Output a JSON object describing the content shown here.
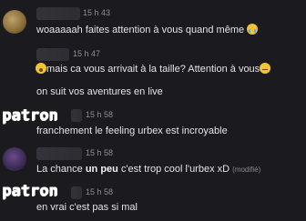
{
  "messages": [
    {
      "time": "15 h 43",
      "text": "woaaaaah faites attention à vous quand même",
      "emoji": "crying-face-icon"
    },
    {
      "time": "15 h 47",
      "text": "mais ca vous arrivait à la taille? Attention à vous",
      "emoji_start": "astonished-face-icon",
      "emoji_end": "neutral-face-icon"
    },
    {
      "text": "on suit vos aventures en live"
    },
    {
      "time": "15 h 58",
      "text": "franchement le feeling urbex est incroyable"
    },
    {
      "time": "15 h 58",
      "text_before": "La chance ",
      "text_bold": "un peu",
      "text_after": " c'est trop cool l'urbex xD",
      "edited": "(modifié)"
    },
    {
      "time": "15 h 58",
      "text": "en vrai c'est pas si mal"
    }
  ],
  "stickers": [
    "patron",
    "patron"
  ],
  "colors": {
    "background": "#1b1a1f",
    "text": "#e4e4e8",
    "timestamp": "#8e8e95"
  }
}
